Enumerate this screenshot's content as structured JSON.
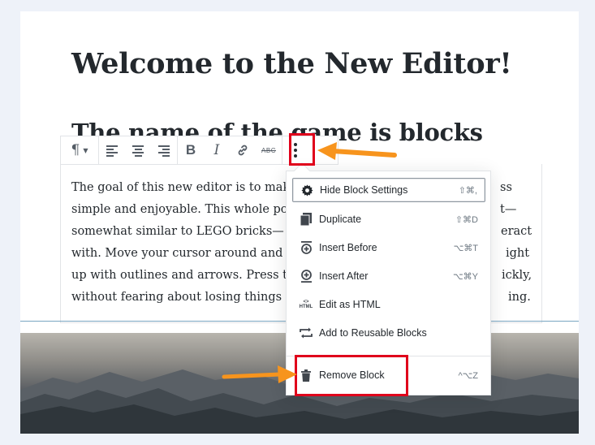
{
  "editor": {
    "title": "Welcome to the New Editor!",
    "subtitle": "The name of the game is blocks"
  },
  "toolbar": {
    "paragraph_symbol": "¶",
    "caret": "▼",
    "bold": "B",
    "italic": "I",
    "link": "🔗",
    "strikethrough": "ABC",
    "more": "⋮"
  },
  "paragraph": {
    "lines": [
      "The goal of this new editor is to make adding rich content to WordPress simple and enjoyable. This whole post is composed of pieces of content—somewhat similar to LEGO bricks—that you can move around and interact with. Move your cursor around and you'll notice the different blocks light up with outlines and arrows. Press the arrows to reposition blocks quickly, without fearing about losing things in the process of copying and pasting."
    ],
    "line1": "The goal of this new editor is to mak",
    "line1_end": "ss",
    "line2": "simple and enjoyable. This whole po",
    "line2_end": "t—",
    "line3": "somewhat similar to LEGO bricks—",
    "line3_end": "eract",
    "line4": "with. Move your cursor around and",
    "line4_end": "ight",
    "line5": "up with outlines and arrows. Press t",
    "line5_end": "ickly,",
    "line6": "without fearing about losing things",
    "line6_end": "ing."
  },
  "menu": {
    "items": [
      {
        "label": "Hide Block Settings",
        "shortcut": "⇧⌘,",
        "icon": "gear-icon"
      },
      {
        "label": "Duplicate",
        "shortcut": "⇧⌘D",
        "icon": "duplicate-icon"
      },
      {
        "label": "Insert Before",
        "shortcut": "⌥⌘T",
        "icon": "insert-before-icon"
      },
      {
        "label": "Insert After",
        "shortcut": "⌥⌘Y",
        "icon": "insert-after-icon"
      },
      {
        "label": "Edit as HTML",
        "shortcut": "",
        "icon": "html-icon",
        "icon_text_top": "<>",
        "icon_text_bottom": "HTML"
      },
      {
        "label": "Add to Reusable Blocks",
        "shortcut": "",
        "icon": "reusable-icon"
      },
      {
        "label": "Remove Block",
        "shortcut": "^⌥Z",
        "icon": "trash-icon"
      }
    ]
  },
  "colors": {
    "highlight": "#e0001b",
    "arrow": "#f7941d",
    "text": "#23282d",
    "background": "#eef2f9"
  }
}
